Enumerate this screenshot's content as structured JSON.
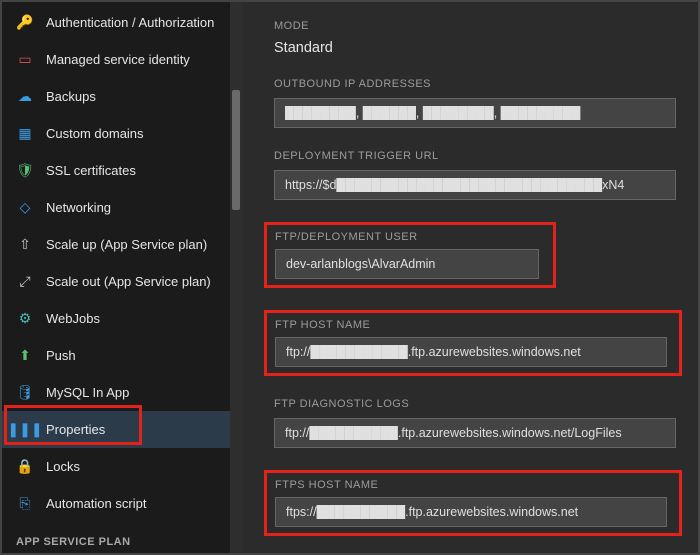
{
  "sidebar": {
    "items": [
      {
        "label": "Authentication / Authorization",
        "icon": "key-icon",
        "glyph": "🔑",
        "cls": "c-yellow"
      },
      {
        "label": "Managed service identity",
        "icon": "id-icon",
        "glyph": "▭",
        "cls": "c-red"
      },
      {
        "label": "Backups",
        "icon": "cloud-icon",
        "glyph": "☁",
        "cls": "c-blue"
      },
      {
        "label": "Custom domains",
        "icon": "domain-icon",
        "glyph": "▦",
        "cls": "c-blue"
      },
      {
        "label": "SSL certificates",
        "icon": "shield-icon",
        "glyph": "🛡",
        "cls": "c-green"
      },
      {
        "label": "Networking",
        "icon": "network-icon",
        "glyph": "◇",
        "cls": "c-blue"
      },
      {
        "label": "Scale up (App Service plan)",
        "icon": "scale-up-icon",
        "glyph": "⇧",
        "cls": "c-gray"
      },
      {
        "label": "Scale out (App Service plan)",
        "icon": "scale-out-icon",
        "glyph": "⤢",
        "cls": "c-gray"
      },
      {
        "label": "WebJobs",
        "icon": "webjobs-icon",
        "glyph": "⚙",
        "cls": "c-teal"
      },
      {
        "label": "Push",
        "icon": "push-icon",
        "glyph": "⬆",
        "cls": "c-green"
      },
      {
        "label": "MySQL In App",
        "icon": "mysql-icon",
        "glyph": "🛢",
        "cls": "c-blue"
      },
      {
        "label": "Properties",
        "icon": "properties-icon",
        "glyph": "❚❚❚",
        "cls": "c-blue",
        "selected": true
      },
      {
        "label": "Locks",
        "icon": "lock-icon",
        "glyph": "🔒",
        "cls": "c-gray"
      },
      {
        "label": "Automation script",
        "icon": "script-icon",
        "glyph": "⎘",
        "cls": "c-blue"
      }
    ],
    "section_header": "APP SERVICE PLAN"
  },
  "content": {
    "mode": {
      "label": "MODE",
      "value": "Standard"
    },
    "outbound_ips": {
      "label": "OUTBOUND IP ADDRESSES",
      "value": "████████, ██████, ████████, █████████"
    },
    "deployment_trigger_url": {
      "label": "DEPLOYMENT TRIGGER URL",
      "value": "https://$d██████████████████████████████xN4"
    },
    "ftp_user": {
      "label": "FTP/DEPLOYMENT USER",
      "value": "dev-arlanblogs\\AlvarAdmin"
    },
    "ftp_host": {
      "label": "FTP HOST NAME",
      "value": "ftp://███████████.ftp.azurewebsites.windows.net"
    },
    "ftp_diag": {
      "label": "FTP DIAGNOSTIC LOGS",
      "value": "ftp://██████████.ftp.azurewebsites.windows.net/LogFiles"
    },
    "ftps_host": {
      "label": "FTPS HOST NAME",
      "value": "ftps://██████████.ftp.azurewebsites.windows.net"
    }
  }
}
